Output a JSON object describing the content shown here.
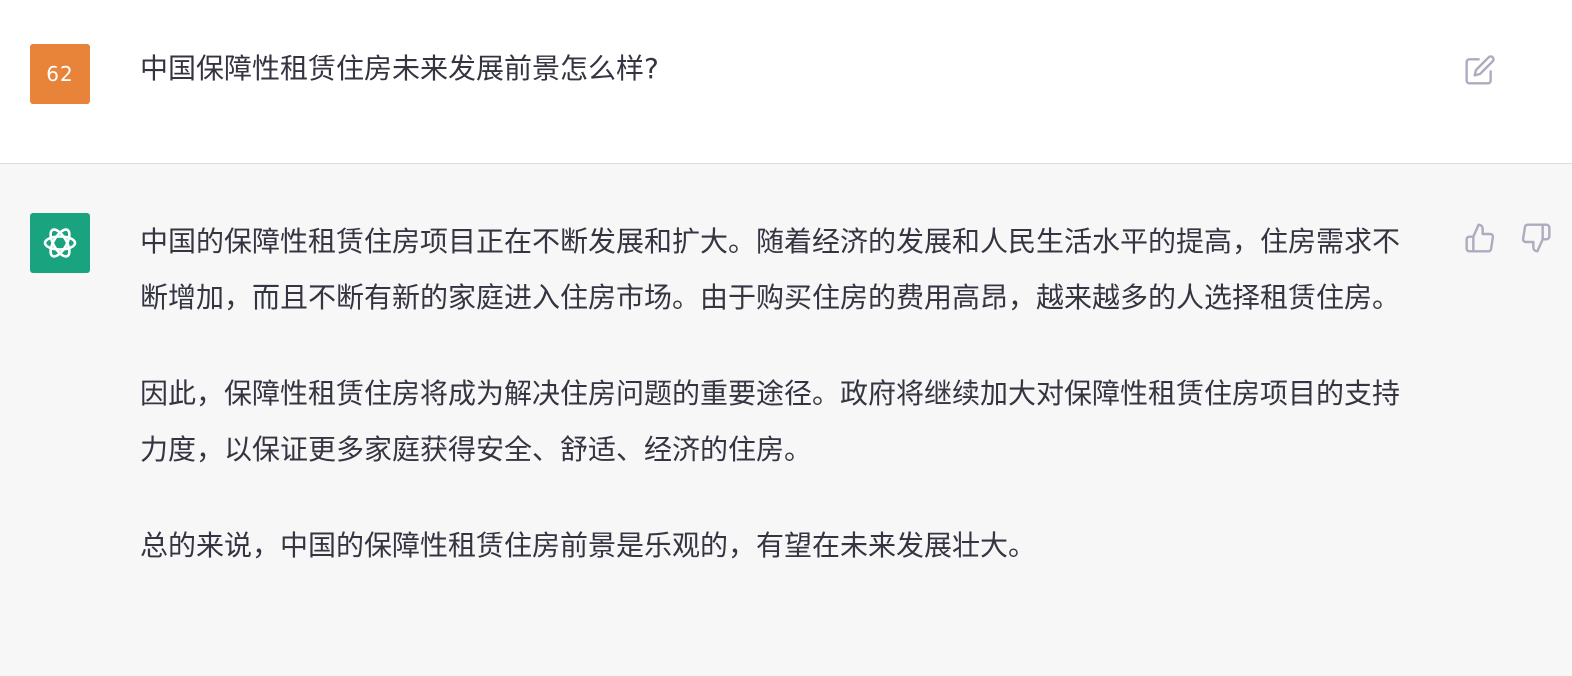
{
  "user_message": {
    "avatar_text": "62",
    "avatar_color": "#e8843a",
    "text": "中国保障性租赁住房未来发展前景怎么样?"
  },
  "assistant_message": {
    "avatar_color": "#19a37f",
    "avatar_icon": "openai-logo-icon",
    "paragraphs": [
      "中国的保障性租赁住房项目正在不断发展和扩大。随着经济的发展和人民生活水平的提高，住房需求不断增加，而且不断有新的家庭进入住房市场。由于购买住房的费用高昂，越来越多的人选择租赁住房。",
      "因此，保障性租赁住房将成为解决住房问题的重要途径。政府将继续加大对保障性租赁住房项目的支持力度，以保证更多家庭获得安全、舒适、经济的住房。",
      "总的来说，中国的保障性租赁住房前景是乐观的，有望在未来发展壮大。"
    ]
  },
  "icons": {
    "edit": "edit-icon",
    "thumbs_up": "thumbs-up-icon",
    "thumbs_down": "thumbs-down-icon"
  }
}
